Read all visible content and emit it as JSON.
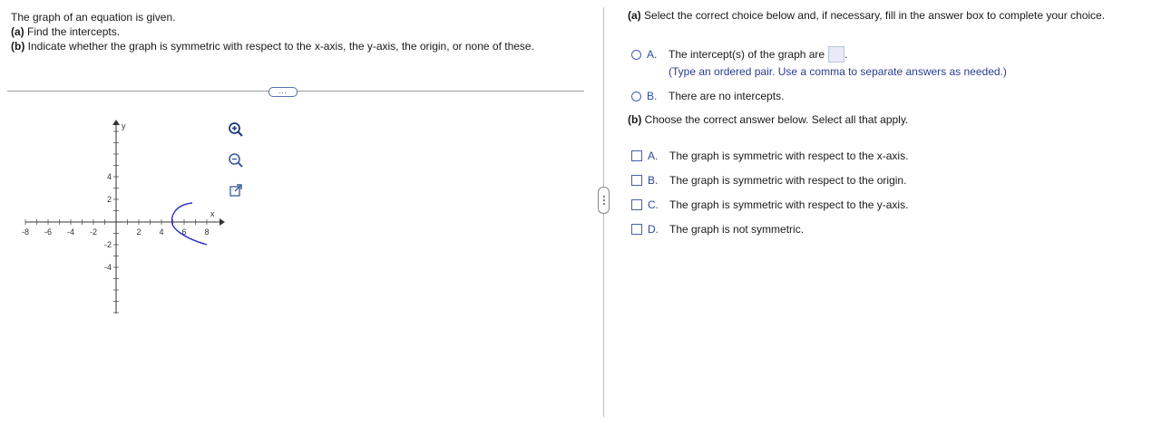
{
  "question": {
    "line1": "The graph of an equation is given.",
    "part_a_label": "(a)",
    "part_a_text": "Find the intercepts.",
    "part_b_label": "(b)",
    "part_b_text": "Indicate whether the graph is symmetric with respect to the x-axis, the y-axis, the origin, or none of these."
  },
  "expand_label": "…",
  "graph": {
    "x_ticks": [
      "-8",
      "-6",
      "-4",
      "-2",
      "2",
      "4",
      "6",
      "8"
    ],
    "y_ticks": [
      "4",
      "2",
      "-2",
      "-4"
    ],
    "x_axis_label": "x",
    "y_axis_label": "y",
    "curve_color": "#2c2fc8"
  },
  "tools": {
    "zoom_in": "zoom-in-icon",
    "zoom_out": "zoom-out-icon",
    "popout": "external-link-icon"
  },
  "part_a": {
    "heading_label": "(a)",
    "heading_text": "Select the correct choice below and, if necessary, fill in the answer box to complete your choice.",
    "choices": [
      {
        "letter": "A.",
        "text": "The intercept(s) of the graph are",
        "after": "."
      },
      {
        "letter": "B.",
        "text": "There are no intercepts."
      }
    ],
    "hint": "(Type an ordered pair. Use a comma to separate answers as needed.)"
  },
  "part_b": {
    "heading_label": "(b)",
    "heading_text": "Choose the correct answer below. Select all that apply.",
    "choices": [
      {
        "letter": "A.",
        "text": "The graph is symmetric with respect to the x-axis."
      },
      {
        "letter": "B.",
        "text": "The graph is symmetric with respect to the origin."
      },
      {
        "letter": "C.",
        "text": "The graph is symmetric with respect to the y-axis."
      },
      {
        "letter": "D.",
        "text": "The graph is not symmetric."
      }
    ]
  },
  "colors": {
    "accent": "#2a4a9e",
    "divider": "#9a9a9a",
    "answer_box": "#e6ebf5"
  }
}
